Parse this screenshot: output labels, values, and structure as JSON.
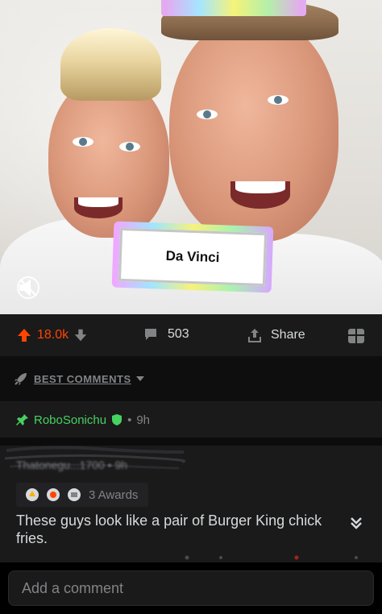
{
  "video": {
    "filter_label": "Da Vinci",
    "mute_icon": "speaker-muted-icon"
  },
  "action_bar": {
    "score": "18.0k",
    "comments_count": "503",
    "share_label": "Share",
    "colors": {
      "upvoted": "#ff4500",
      "text": "#d7dadc"
    }
  },
  "sort": {
    "label": "BEST COMMENTS",
    "icon": "rocket-icon"
  },
  "pinned": {
    "username": "RoboSonichu",
    "separator": "•",
    "age": "9h",
    "color": "#46d160"
  },
  "comment": {
    "author_line": "Thatonegu...1700 • 9h",
    "awards_label": "3 Awards",
    "body": "These guys look like a pair of Burger King chick fries."
  },
  "composer": {
    "placeholder": "Add a comment"
  }
}
